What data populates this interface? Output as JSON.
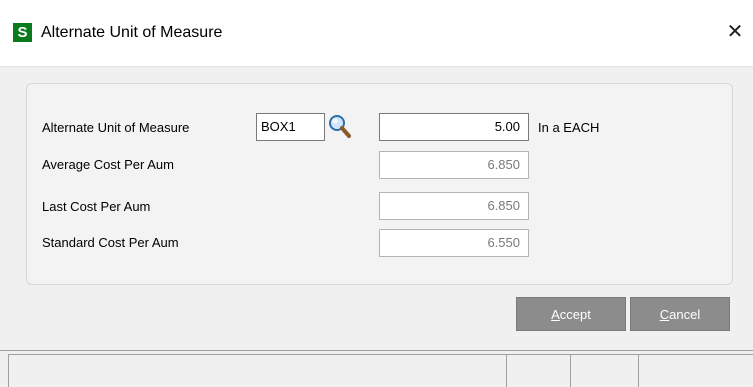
{
  "window": {
    "title": "Alternate Unit of Measure",
    "app_icon_letter": "S",
    "close_glyph": "✕"
  },
  "form": {
    "aum": {
      "label": "Alternate Unit of Measure",
      "value": "BOX1",
      "lookup_icon": "magnifier-icon"
    },
    "quantity": {
      "value": "5.00",
      "unit_text": "In a EACH"
    },
    "average_cost": {
      "label": "Average Cost Per Aum",
      "value": "6.850"
    },
    "last_cost": {
      "label": "Last Cost Per Aum",
      "value": "6.850"
    },
    "standard_cost": {
      "label": "Standard Cost Per Aum",
      "value": "6.550"
    }
  },
  "buttons": {
    "accept": {
      "accel": "A",
      "rest": "ccept"
    },
    "cancel": {
      "accel": "C",
      "rest": "ancel"
    }
  },
  "colors": {
    "app_icon_bg": "#0a7a1e",
    "button_bg": "#8c8c8c"
  }
}
